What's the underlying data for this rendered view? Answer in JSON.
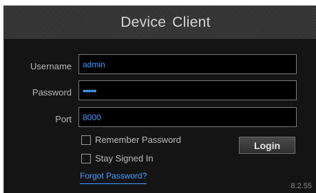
{
  "window": {
    "title": "Device  Client"
  },
  "form": {
    "username": {
      "label": "Username",
      "value": "admin"
    },
    "password": {
      "label": "Password",
      "value": "•••••"
    },
    "port": {
      "label": "Port",
      "value": "8000"
    }
  },
  "options": {
    "remember_password": {
      "label": "Remember Password",
      "checked": false
    },
    "stay_signed_in": {
      "label": "Stay Signed In",
      "checked": false
    }
  },
  "actions": {
    "login_label": "Login",
    "forgot_password_label": "Forgot Password?"
  },
  "footer": {
    "version": "8.2.55"
  },
  "colors": {
    "background": "#141414",
    "title_bar": "#363636",
    "accent_text": "#4a9bff",
    "label_text": "#b9b9b9"
  }
}
